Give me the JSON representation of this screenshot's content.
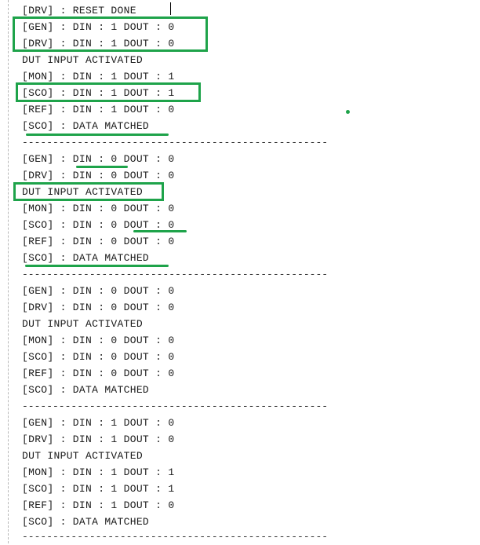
{
  "log_lines": [
    "[DRV] : RESET DONE",
    "[GEN] : DIN : 1 DOUT : 0",
    "[DRV] : DIN : 1 DOUT : 0",
    "DUT INPUT ACTIVATED",
    "[MON] : DIN : 1 DOUT : 1",
    "[SCO] : DIN : 1 DOUT : 1",
    "[REF] : DIN : 1 DOUT : 0",
    "[SCO] : DATA MATCHED",
    "--------------------------------------------------",
    "[GEN] : DIN : 0 DOUT : 0",
    "[DRV] : DIN : 0 DOUT : 0",
    "DUT INPUT ACTIVATED",
    "[MON] : DIN : 0 DOUT : 0",
    "[SCO] : DIN : 0 DOUT : 0",
    "[REF] : DIN : 0 DOUT : 0",
    "[SCO] : DATA MATCHED",
    "--------------------------------------------------",
    "[GEN] : DIN : 0 DOUT : 0",
    "[DRV] : DIN : 0 DOUT : 0",
    "DUT INPUT ACTIVATED",
    "[MON] : DIN : 0 DOUT : 0",
    "[SCO] : DIN : 0 DOUT : 0",
    "[REF] : DIN : 0 DOUT : 0",
    "[SCO] : DATA MATCHED",
    "--------------------------------------------------",
    "[GEN] : DIN : 1 DOUT : 0",
    "[DRV] : DIN : 1 DOUT : 0",
    "DUT INPUT ACTIVATED",
    "[MON] : DIN : 1 DOUT : 1",
    "[SCO] : DIN : 1 DOUT : 1",
    "[REF] : DIN : 1 DOUT : 0",
    "[SCO] : DATA MATCHED",
    "--------------------------------------------------"
  ],
  "colors": {
    "annotation": "#1ea34a",
    "text": "#1a1a1a",
    "background": "#ffffff"
  }
}
